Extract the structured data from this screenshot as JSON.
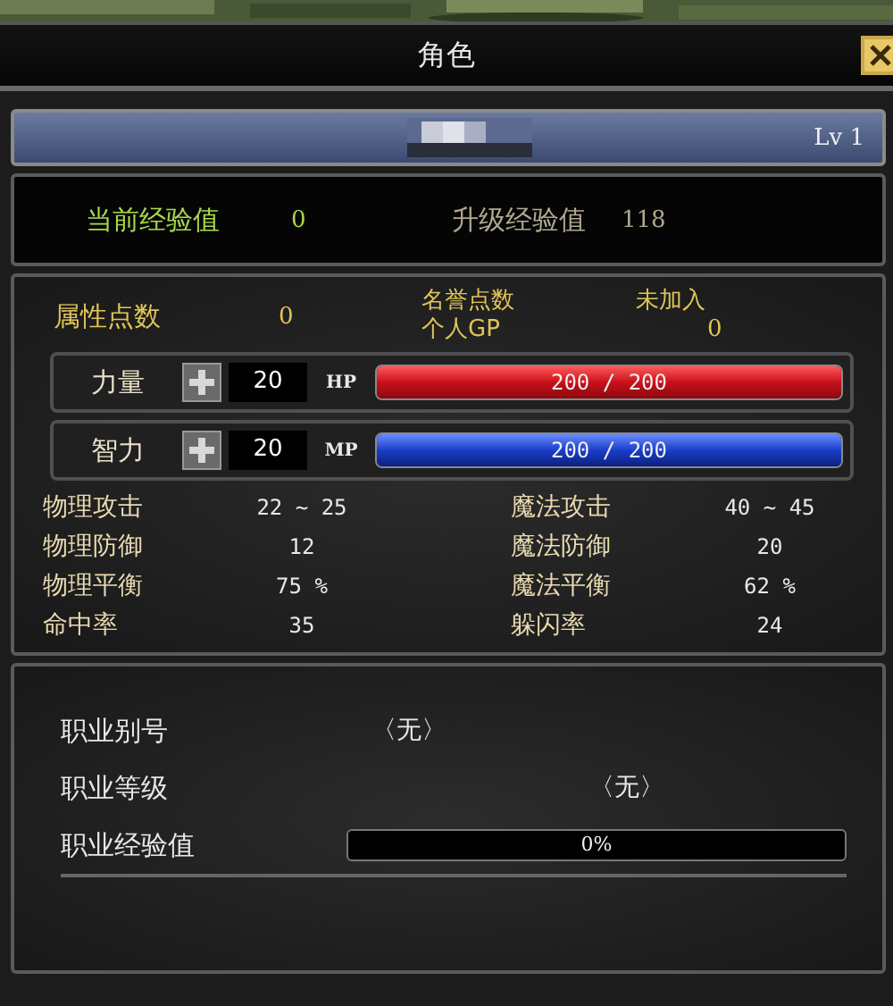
{
  "window": {
    "title": "角色"
  },
  "header": {
    "level": "Lv 1"
  },
  "experience": [
    {
      "label": "当前经验值",
      "value": "0",
      "highlight": true
    },
    {
      "label": "升级经验值",
      "value": "118",
      "highlight": false
    }
  ],
  "points": {
    "label": "属性点数",
    "value": "0"
  },
  "honor": {
    "label": "名誉点数",
    "value": "未加入",
    "gp_label": "个人GP",
    "gp_value": "0"
  },
  "attributes": [
    {
      "label": "力量",
      "value": "20",
      "bar_label": "HP",
      "reading": "200 / 200",
      "level": 1,
      "kind": "hp"
    },
    {
      "label": "智力",
      "value": "20",
      "bar_label": "MP",
      "reading": "200 / 200",
      "level": 1,
      "kind": "mp"
    }
  ],
  "stats": [
    {
      "label": "物理攻击",
      "value": "22 ~ 25"
    },
    {
      "label": "魔法攻击",
      "value": "40 ~ 45"
    },
    {
      "label": "物理防御",
      "value": "12"
    },
    {
      "label": "魔法防御",
      "value": "20"
    },
    {
      "label": "物理平衡",
      "value": "75 %"
    },
    {
      "label": "魔法平衡",
      "value": "62 %"
    },
    {
      "label": "命中率",
      "value": "35"
    },
    {
      "label": "躲闪率",
      "value": "24"
    }
  ],
  "job": [
    {
      "label": "职业别号",
      "value": "〈无〉",
      "kind": "near"
    },
    {
      "label": "职业等级",
      "value": "〈无〉",
      "kind": "far"
    }
  ],
  "job_exp": {
    "label": "职业经验值",
    "reading": "0%",
    "level": 0
  }
}
